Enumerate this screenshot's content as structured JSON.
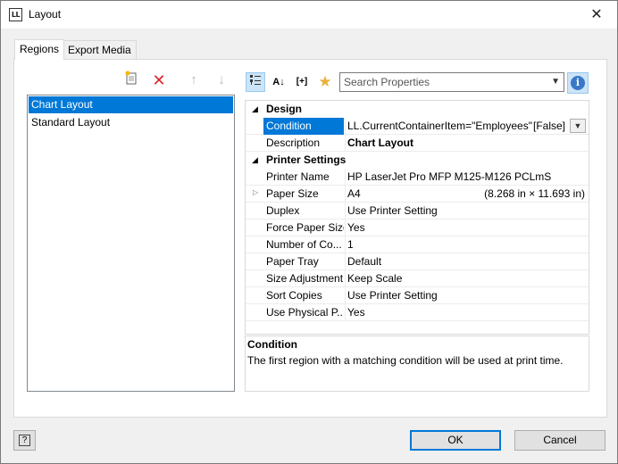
{
  "window": {
    "title": "Layout",
    "icon_text": "LL"
  },
  "tabs": [
    {
      "label": "Regions"
    },
    {
      "label": "Export Media"
    }
  ],
  "regions": {
    "items": [
      {
        "label": "Chart Layout"
      },
      {
        "label": "Standard Layout"
      }
    ],
    "selected_index": 0
  },
  "toolbar": {
    "search_placeholder": "Search Properties"
  },
  "properties": {
    "categories": [
      {
        "name": "Design",
        "rows": [
          {
            "name": "Condition",
            "value": "LL.CurrentContainerItem=\"Employees\"",
            "extra": "[False]"
          },
          {
            "name": "Description",
            "value": "Chart Layout"
          }
        ]
      },
      {
        "name": "Printer Settings",
        "rows": [
          {
            "name": "Printer Name",
            "value": "HP LaserJet Pro MFP M125-M126 PCLmS"
          },
          {
            "name": "Paper Size",
            "value": "A4",
            "extra": "(8.268 in × 11.693 in)"
          },
          {
            "name": "Duplex",
            "value": "Use Printer Setting"
          },
          {
            "name": "Force Paper Size",
            "value": "Yes"
          },
          {
            "name": "Number of Co...",
            "value": "1"
          },
          {
            "name": "Paper Tray",
            "value": "Default"
          },
          {
            "name": "Size Adjustment",
            "value": "Keep Scale"
          },
          {
            "name": "Sort Copies",
            "value": "Use Printer Setting"
          },
          {
            "name": "Use Physical P...",
            "value": "Yes"
          }
        ]
      }
    ]
  },
  "description_panel": {
    "title": "Condition",
    "text": "The first region with a matching condition will be used at print time."
  },
  "buttons": {
    "ok": "OK",
    "cancel": "Cancel",
    "help": "?"
  }
}
